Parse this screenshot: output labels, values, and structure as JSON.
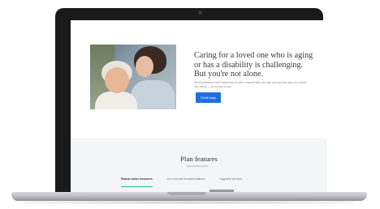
{
  "hero": {
    "headline": "Caring for a loved one who is aging or has a disability is challenging. But you're not alone.",
    "subtext": "We've partnered with HelloHome to offer a benefit that can help you and the care your loved one needs — at no cost to you.",
    "cta_label": "Enroll today",
    "photo_alt": "older-woman-and-daughter-photo"
  },
  "features": {
    "title": "Plan features",
    "link_text": "View summary PDF →",
    "tabs": [
      {
        "label": "Robust online resources",
        "active": true
      },
      {
        "label": "Live chat and recommendations",
        "active": false
      },
      {
        "label": "Upgraded services",
        "active": false
      }
    ]
  },
  "colors": {
    "accent": "#1e6fe0",
    "tab_underline": "#2bb3a3",
    "band": "#f4f5f6"
  }
}
